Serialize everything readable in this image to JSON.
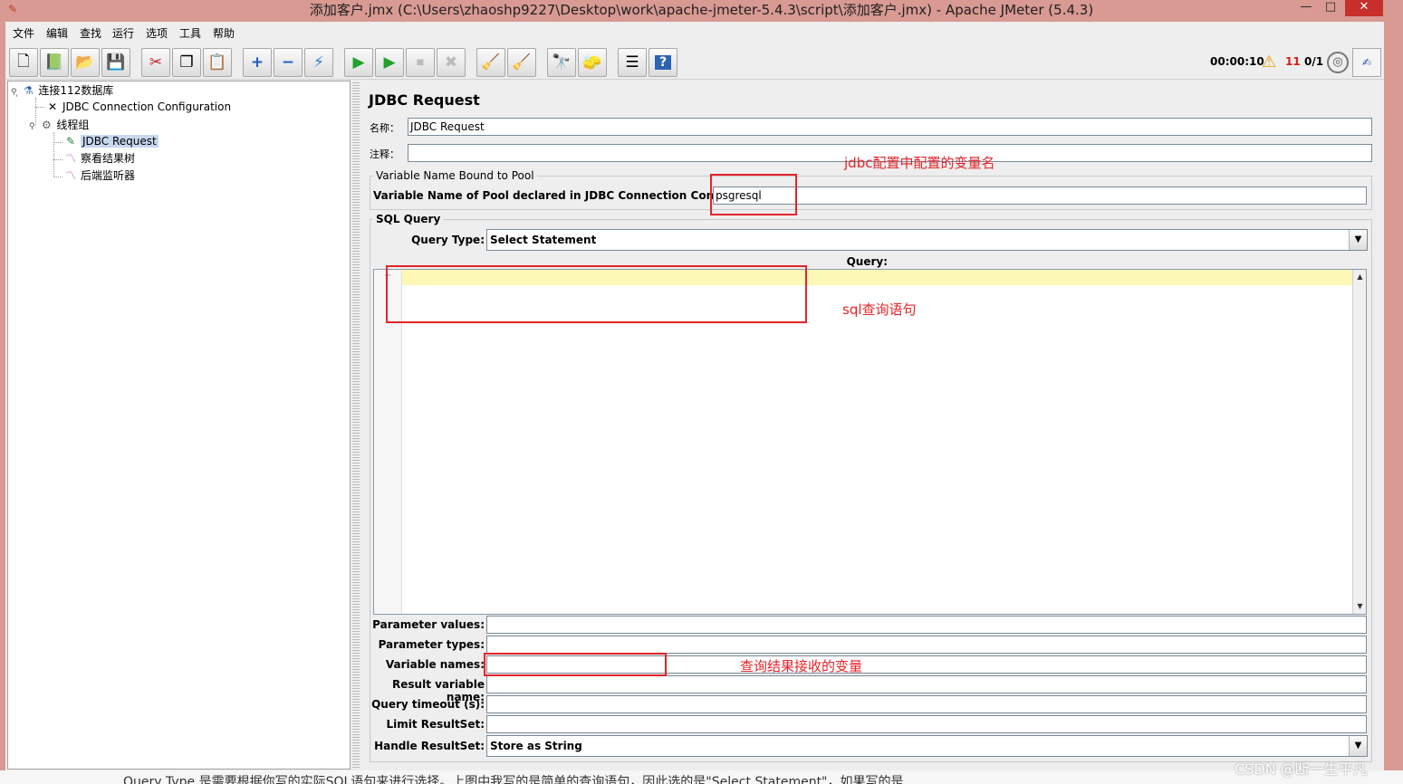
{
  "window": {
    "title": "添加客户.jmx (C:\\Users\\zhaoshp9227\\Desktop\\work\\apache-jmeter-5.4.3\\script\\添加客户.jmx) - Apache JMeter (5.4.3)",
    "minimize": "—",
    "maximize": "□",
    "close": "✕"
  },
  "menu": [
    "文件",
    "编辑",
    "查找",
    "运行",
    "选项",
    "工具",
    "帮助"
  ],
  "toolbar": {
    "buttons": [
      {
        "name": "new-icon",
        "glyph": "🗋"
      },
      {
        "name": "templates-icon",
        "glyph": "📗"
      },
      {
        "name": "open-icon",
        "glyph": "📂"
      },
      {
        "name": "save-icon",
        "glyph": "💾"
      },
      {
        "name": "cut-icon",
        "glyph": "✂"
      },
      {
        "name": "copy-icon",
        "glyph": "❐"
      },
      {
        "name": "paste-icon",
        "glyph": "📋"
      },
      {
        "name": "expand-icon",
        "glyph": "+"
      },
      {
        "name": "collapse-icon",
        "glyph": "−"
      },
      {
        "name": "toggle-icon",
        "glyph": "⚡"
      },
      {
        "name": "start-icon",
        "glyph": "▶"
      },
      {
        "name": "start-no-pause-icon",
        "glyph": "▶"
      },
      {
        "name": "stop-icon",
        "glyph": "⏹"
      },
      {
        "name": "shutdown-icon",
        "glyph": "✖"
      },
      {
        "name": "clear-icon",
        "glyph": "🧹"
      },
      {
        "name": "clear-all-icon",
        "glyph": "🧹"
      },
      {
        "name": "search-icon",
        "glyph": "🔭"
      },
      {
        "name": "reset-search-icon",
        "glyph": "🧽"
      },
      {
        "name": "function-helper-icon",
        "glyph": "☰"
      },
      {
        "name": "help-icon",
        "glyph": "?"
      }
    ],
    "timer": "00:00:10",
    "warning_icon": "⚠",
    "warning_count": "11",
    "threads": "0/1"
  },
  "tree": {
    "root": "连接112数据库",
    "jdbc_config": "JDBC Connection Configuration",
    "thread_group": "线程组",
    "jdbc_request": "JDBC Request",
    "result_tree": "察看结果树",
    "backend_listener": "后端监听器"
  },
  "panel": {
    "title": "JDBC Request",
    "name_label": "名称：",
    "name_value": "JDBC Request",
    "comment_label": "注释：",
    "comment_value": "",
    "pool_group": "Variable Name Bound to Pool",
    "pool_label": "Variable Name of Pool declared in JDBC Connection Configuration",
    "pool_value": "psgresql",
    "sql_group": "SQL Query",
    "query_type_label": "Query Type:",
    "query_type_value": "Select Statement",
    "query_label": "Query:",
    "query_value": "",
    "param_values_label": "Parameter values:",
    "param_types_label": "Parameter types:",
    "variable_names_label": "Variable names:",
    "result_variable_label": "Result variable name:",
    "query_timeout_label": "Query timeout (s):",
    "limit_resultset_label": "Limit ResultSet:",
    "handle_resultset_label": "Handle ResultSet:",
    "handle_resultset_value": "Store as String"
  },
  "annotations": {
    "pool_note": "jdbc配置中配置的变量名",
    "sql_note": "sql查询语句",
    "varnames_note": "查询结果接收的变量"
  },
  "page_footer": {
    "bottom_text": "Query Type 是需要根据你写的实际SQL语句来进行选择。上图中我写的是简单的查询语句，因此选的是\"Select Statement\"，如果写的是",
    "watermark": "CSDN @断一生平凡"
  }
}
